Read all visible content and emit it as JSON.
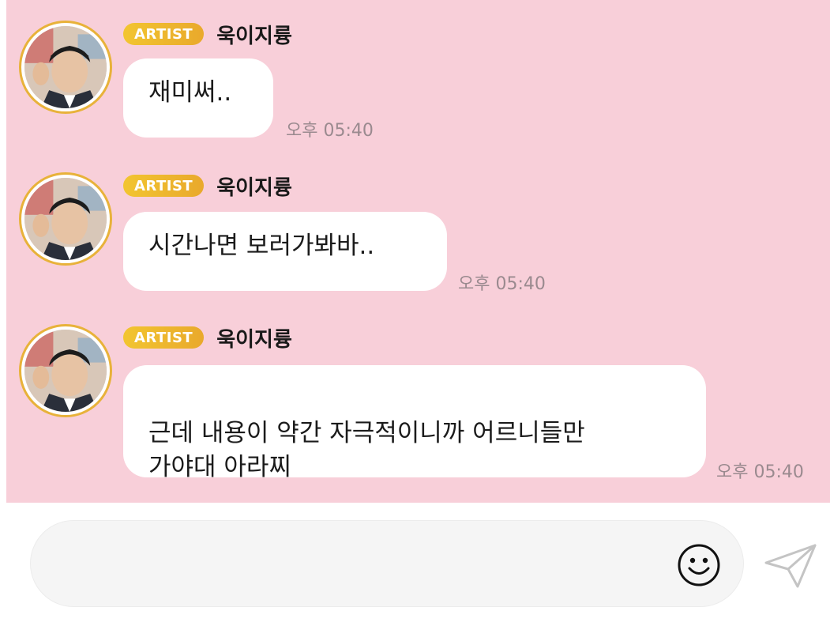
{
  "messages": [
    {
      "badge": "ARTIST",
      "sender": "욱이지륭",
      "text": "재미써..",
      "time": "오후 05:40"
    },
    {
      "badge": "ARTIST",
      "sender": "욱이지륭",
      "text": "시간나면 보러가봐바..",
      "time": "오후 05:40"
    },
    {
      "badge": "ARTIST",
      "sender": "욱이지륭",
      "text": "근데 내용이 약간 자극적이니까 어르니들만\n가야대 아라찌",
      "time": "오후 05:40"
    }
  ],
  "composer": {
    "placeholder": "",
    "emoji_icon": "smiley-icon",
    "send_icon": "paper-plane-icon"
  },
  "colors": {
    "chat_background": "#f8cfd9",
    "badge_gradient_start": "#f2c530",
    "badge_gradient_end": "#e9a92c",
    "avatar_ring": "#e8b23a"
  }
}
